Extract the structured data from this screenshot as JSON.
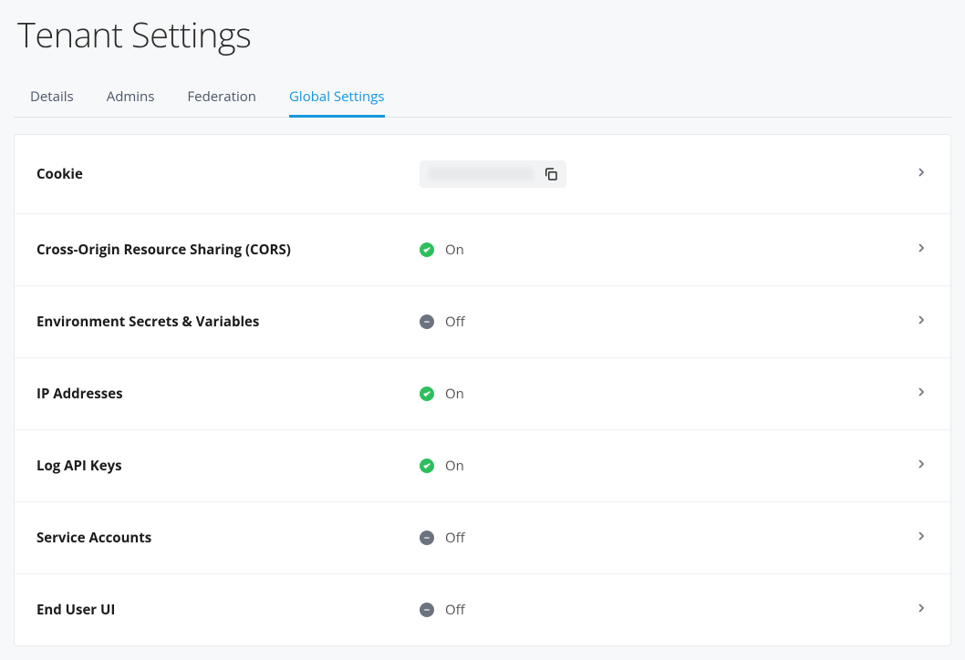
{
  "page": {
    "title": "Tenant Settings"
  },
  "tabs": [
    {
      "label": "Details",
      "active": false
    },
    {
      "label": "Admins",
      "active": false
    },
    {
      "label": "Federation",
      "active": false
    },
    {
      "label": "Global Settings",
      "active": true
    }
  ],
  "rows": {
    "cookie": {
      "label": "Cookie",
      "type": "redacted"
    },
    "cors": {
      "label": "Cross-Origin Resource Sharing (CORS)",
      "type": "status",
      "state": "on",
      "text": "On"
    },
    "env": {
      "label": "Environment Secrets & Variables",
      "type": "status",
      "state": "off",
      "text": "Off"
    },
    "ip": {
      "label": "IP Addresses",
      "type": "status",
      "state": "on",
      "text": "On"
    },
    "log": {
      "label": "Log API Keys",
      "type": "status",
      "state": "on",
      "text": "On"
    },
    "svc": {
      "label": "Service Accounts",
      "type": "status",
      "state": "off",
      "text": "Off"
    },
    "eui": {
      "label": "End User UI",
      "type": "status",
      "state": "off",
      "text": "Off"
    }
  }
}
